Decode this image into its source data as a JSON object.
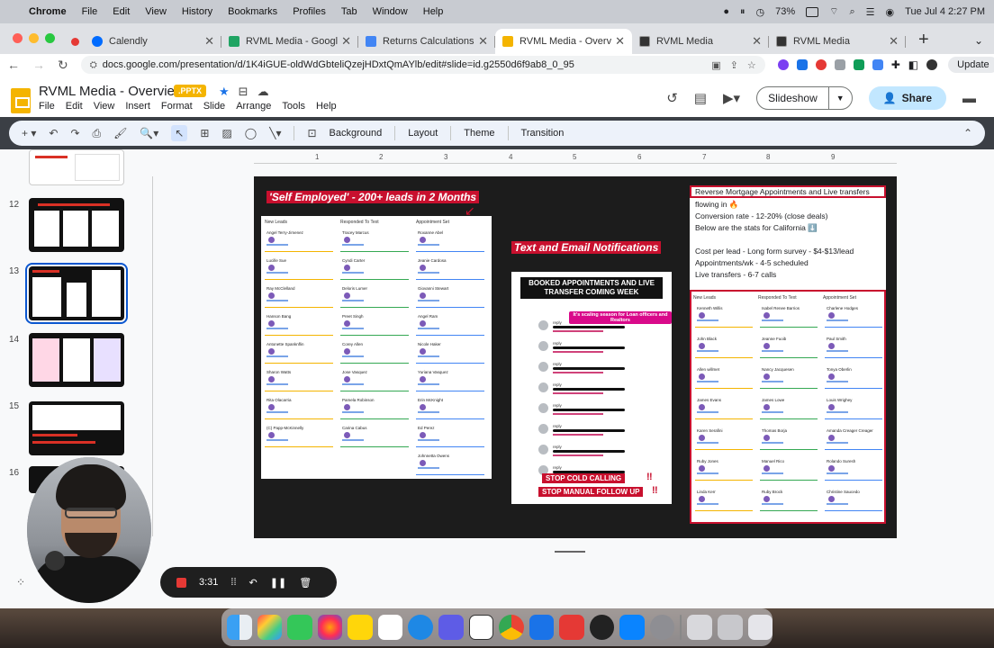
{
  "menubar": {
    "app": "Chrome",
    "items": [
      "File",
      "Edit",
      "View",
      "History",
      "Bookmarks",
      "Profiles",
      "Tab",
      "Window",
      "Help"
    ],
    "battery": "73%",
    "datetime": "Tue Jul 4  2:27 PM"
  },
  "tabs": [
    {
      "title": "Calendly",
      "color": "#006bff",
      "active": false
    },
    {
      "title": "RVML Media - Google Dri",
      "color": "#1fa463",
      "active": false
    },
    {
      "title": "Returns Calculations!! - G",
      "color": "#4285f4",
      "active": false
    },
    {
      "title": "RVML Media - Overvie",
      "color": "#f4b400",
      "active": true
    },
    {
      "title": "RVML Media",
      "color": "#333333",
      "active": false
    },
    {
      "title": "RVML Media",
      "color": "#333333",
      "active": false
    }
  ],
  "omnibox": {
    "url": "docs.google.com/presentation/d/1K4iGUE-oldWdGbteliQzejHDxtQmAYlb/edit#slide=id.g2550d6f9ab8_0_95",
    "update_label": "Update"
  },
  "docs": {
    "title": "RVML Media - Overview",
    "badge": ".PPTX",
    "menus": [
      "File",
      "Edit",
      "View",
      "Insert",
      "Format",
      "Slide",
      "Arrange",
      "Tools",
      "Help"
    ],
    "slideshow_label": "Slideshow",
    "share_label": "Share"
  },
  "toolbar": {
    "background_label": "Background",
    "layout_label": "Layout",
    "theme_label": "Theme",
    "transition_label": "Transition"
  },
  "filmstrip": {
    "numbers": [
      "12",
      "13",
      "14",
      "15",
      "16"
    ],
    "selected": "13"
  },
  "ruler": [
    "1",
    "2",
    "3",
    "4",
    "5",
    "6",
    "7",
    "8",
    "9"
  ],
  "slide": {
    "heading_left": "'Self Employed' - 200+ leads in 2 Months",
    "heading_mid": "Text and Email Notifications",
    "left_columns": [
      "New Leads",
      "Responded To Text",
      "Appointment Set"
    ],
    "left_names": [
      [
        "Angel Terry-Jimenez",
        "Tracey Marcus",
        "Roxanne Abel"
      ],
      [
        "Lucille Sue",
        "Cyndi Carter",
        "Jeanie Cardosa"
      ],
      [
        "Ray McClelland",
        "Deloris Lumer",
        "Giovanni Stewart"
      ],
      [
        "Hanson Bang",
        "Preet Singh",
        "Angel Ram"
      ],
      [
        "Antonette Spanknflin",
        "Corey Allen",
        "Nicole Haker"
      ],
      [
        "Sharon Watts",
        "Jose Vasquez",
        "Yuriana Vasquez"
      ],
      [
        "Rita Olacarria",
        "Pamela Robinson",
        "Erin McKnight"
      ],
      [
        "(C) Papp-McKinnelly",
        "Carina Cabus",
        "Ed Perez"
      ],
      [
        "",
        "",
        "Johnnetta Owens"
      ]
    ],
    "phone_title": "BOOKED APPOINTMENTS AND LIVE TRANSFER COMING WEEK",
    "phone_pill": "It's scaling season for Loan officers and Realtors",
    "phone_msgs": [
      "reply",
      "reply",
      "reply",
      "reply",
      "reply",
      "reply",
      "reply",
      "reply"
    ],
    "stop1": "STOP COLD CALLING",
    "stop2": "STOP MANUAL FOLLOW UP",
    "stats_heading": "Reverse Mortgage Appointments and Live transfers",
    "stats_lines": [
      "flowing in 🔥",
      "Conversion rate - 12-20% (close deals)",
      "Below are the stats for California ⬇️",
      "",
      "Cost per lead - Long form survey - $4-$13/lead",
      "Appointments/wk - 4-5 scheduled",
      "Live transfers - 6-7 calls"
    ],
    "right_columns": [
      "New Leads",
      "Responded To Text",
      "Appointment Set"
    ],
    "right_names": [
      [
        "Kenneth Willis",
        "Isabel Renee Barrios",
        "Charlene Hodges"
      ],
      [
        "John Black",
        "Jeanne Fuoib",
        "Paul Smith"
      ],
      [
        "Allen willmet",
        "Nancy Jacquesen",
        "Tonya Oberlin"
      ],
      [
        "James Evans",
        "James Lowe",
        "Louis Wrighey"
      ],
      [
        "Karen Serafini",
        "Thomas Borja",
        "Amanda Creager Creager"
      ],
      [
        "Ruby Jones",
        "Manuel Rico",
        "Rolando Suresh"
      ],
      [
        "Linda Kerr",
        "Ruby Brock",
        "Christine Saucedo"
      ]
    ]
  },
  "recorder": {
    "time": "3:31"
  },
  "colors": {
    "accent_red": "#c8102e",
    "docs_yellow": "#f4b400",
    "share_blue": "#c2e7ff"
  }
}
